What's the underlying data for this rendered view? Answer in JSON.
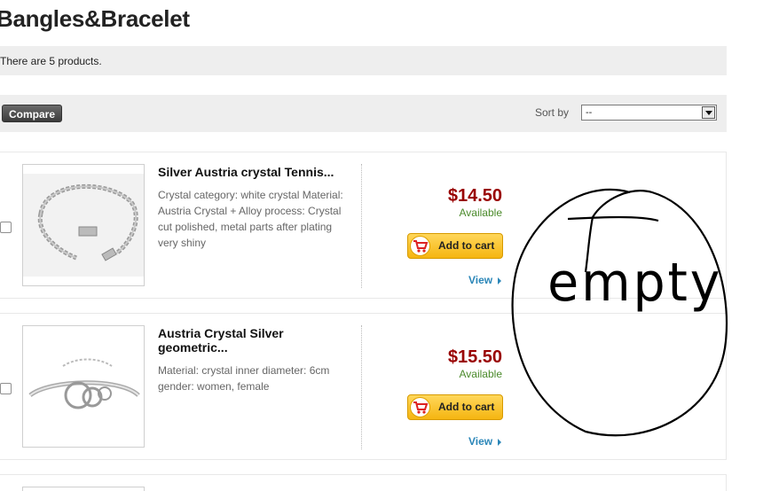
{
  "page": {
    "title": "Bangles&Bracelet",
    "product_count": "There are 5 products."
  },
  "toolbar": {
    "compare_label": "Compare",
    "sort_label": "Sort by",
    "sort_value": "--"
  },
  "products": [
    {
      "name": "Silver Austria crystal Tennis...",
      "description": "Crystal category: white crystal Material: Austria Crystal + Alloy process: Crystal cut polished, metal parts after plating very shiny",
      "price": "$14.50",
      "availability": "Available",
      "cart_label": "Add to cart",
      "view_label": "View"
    },
    {
      "name": "Austria Crystal Silver geometric...",
      "description": "Material: crystal inner diameter: 6cm gender: women, female",
      "price": "$15.50",
      "availability": "Available",
      "cart_label": "Add to cart",
      "view_label": "View"
    }
  ],
  "annotation": {
    "text": "empty"
  },
  "colors": {
    "price": "#990000",
    "available": "#4a8a2a",
    "link": "#2a86b8",
    "cart_button": "#f5b511"
  }
}
